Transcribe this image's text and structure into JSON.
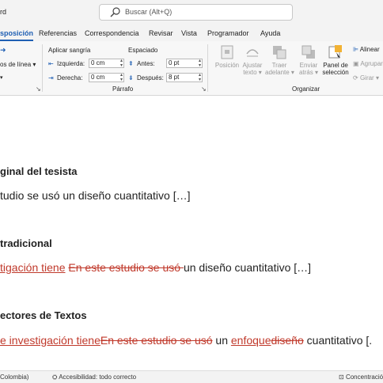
{
  "titlebar": {
    "app_fragment": "rd",
    "search_placeholder": "Buscar (Alt+Q)"
  },
  "tabs": [
    {
      "label": "sposición",
      "active": true
    },
    {
      "label": "Referencias",
      "active": false
    },
    {
      "label": "Correspondencia",
      "active": false
    },
    {
      "label": "Revisar",
      "active": false
    },
    {
      "label": "Vista",
      "active": false
    },
    {
      "label": "Programador",
      "active": false
    },
    {
      "label": "Ayuda",
      "active": false
    }
  ],
  "ribbon": {
    "lines_fragment": "os de línea",
    "sangria_title": "Aplicar sangría",
    "izquierda_label": "Izquierda:",
    "izquierda_value": "0 cm",
    "derecha_label": "Derecha:",
    "derecha_value": "0 cm",
    "espaciado_title": "Espaciado",
    "antes_label": "Antes:",
    "antes_value": "0 pt",
    "despues_label": "Después:",
    "despues_value": "8 pt",
    "parrafo_group": "Párrafo",
    "posicion_label": "Posición",
    "ajustar_label1": "Ajustar",
    "ajustar_label2": "texto",
    "traer_label1": "Traer",
    "traer_label2": "adelante",
    "enviar_label1": "Enviar",
    "enviar_label2": "atrás",
    "panel_label1": "Panel de",
    "panel_label2": "selección",
    "alinear_label": "Alinear",
    "agrupar_label": "Agrupar",
    "girar_label": "Girar",
    "organizar_group": "Organizar"
  },
  "document": {
    "h1": "ginal del tesista",
    "p1": "tudio se usó un diseño cuantitativo […]",
    "h2": "tradicional",
    "p2_ins": "tigación tiene",
    "p2_del": "En este estudio se usó ",
    "p2_rest": "un diseño cuantitativo […]",
    "h3": "ectores de Textos",
    "p3_ins1": "e investigación tiene",
    "p3_del1": "En este estudio se usó",
    "p3_plain1": " un ",
    "p3_ins2": "enfoque",
    "p3_del2": "diseño",
    "p3_plain2": " cuantitativo [."
  },
  "status": {
    "language_fragment": "Colombia)",
    "accessibility": "Accesibilidad: todo correcto",
    "focus_fragment": "Concentració"
  }
}
